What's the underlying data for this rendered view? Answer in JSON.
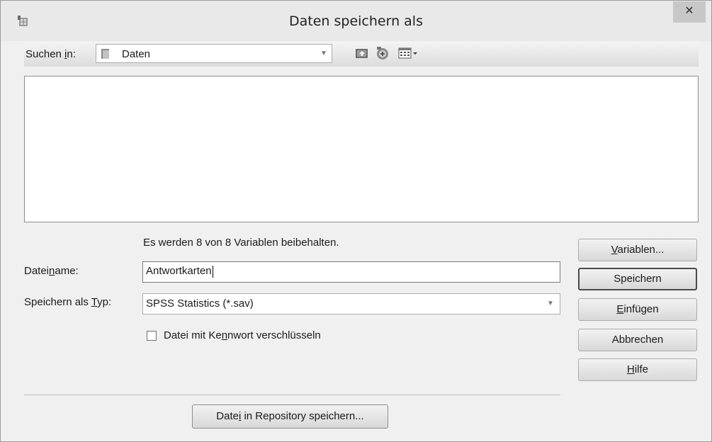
{
  "window": {
    "title": "Daten speichern als",
    "close_glyph": "✕"
  },
  "toolbar": {
    "lookin_label": "Suchen in:",
    "lookin_value": "Daten",
    "icons": [
      "folder-icon",
      "up-folder-icon",
      "new-folder-icon",
      "view-menu-icon"
    ]
  },
  "info_text": "Es werden 8 von 8 Variablen beibehalten.",
  "form": {
    "filename_label": "Dateiname:",
    "filename_value": "Antwortkarten",
    "type_label": "Speichern als Typ:",
    "type_value": "SPSS Statistics (*.sav)",
    "encrypt_label": "Datei mit Kennwort verschlüsseln",
    "encrypt_checked": false
  },
  "buttons": {
    "variables": "Variablen...",
    "save": "Speichern",
    "paste": "Einfügen",
    "cancel": "Abbrechen",
    "help": "Hilfe",
    "repository": "Datei in Repository speichern..."
  }
}
